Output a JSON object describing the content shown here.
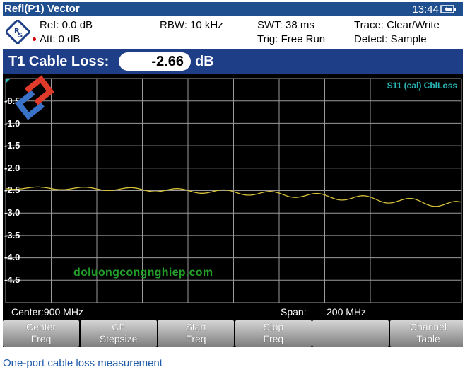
{
  "title": "Refl(P1) Vector",
  "clock": "13:44",
  "info": {
    "ref": "Ref:  0.0 dB",
    "att": "Att:  0 dB",
    "rbw": "RBW:  10 kHz",
    "swt": "SWT:  38 ms",
    "trig": "Trig:  Free Run",
    "trace": "Trace:  Clear/Write",
    "detect": "Detect:  Sample"
  },
  "marker": {
    "label": "T1 Cable Loss:",
    "value": "-2.66",
    "unit": "dB"
  },
  "graph": {
    "trace_label": "S11 (cal) CblLoss",
    "y_ticks": [
      "-0.5",
      "-1.0",
      "-1.5",
      "-2.0",
      "-2.5",
      "-3.0",
      "-3.5",
      "-4.0",
      "-4.5"
    ],
    "trace_color": "#d8c23a"
  },
  "watermark": "doluongcongnghiep.com",
  "status": {
    "center": "Center:900 MHz",
    "span_label": "Span:",
    "span_value": "200 MHz"
  },
  "softkeys": [
    {
      "line1": "Center",
      "line2": "Freq"
    },
    {
      "line1": "CF",
      "line2": "Stepsize"
    },
    {
      "line1": "Start",
      "line2": "Freq"
    },
    {
      "line1": "Stop",
      "line2": "Freq"
    },
    {
      "line1": "",
      "line2": ""
    },
    {
      "line1": "Channel",
      "line2": "Table"
    }
  ],
  "caption": "One-port cable loss measurement"
}
